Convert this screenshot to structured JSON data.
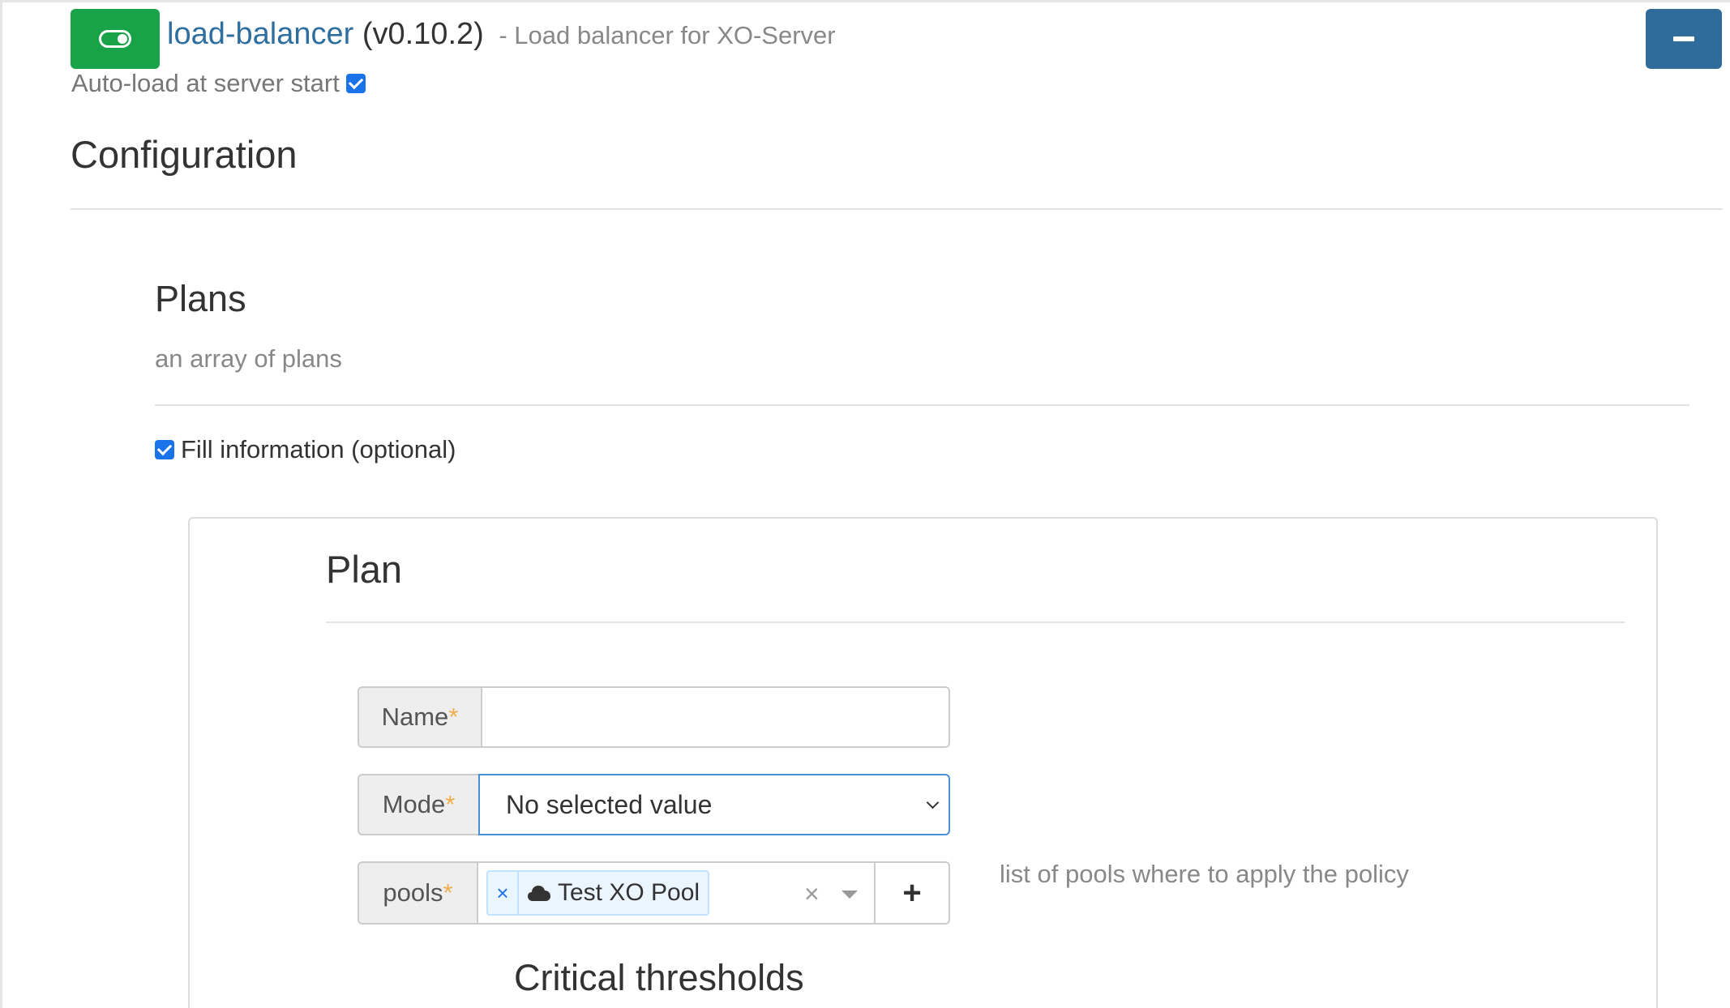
{
  "plugin": {
    "name": "load-balancer",
    "version": "(v0.10.2)",
    "description": "- Load balancer for XO-Server",
    "autoload_label": "Auto-load at server start",
    "autoload_checked": true
  },
  "configuration": {
    "title": "Configuration",
    "plans": {
      "title": "Plans",
      "description": "an array of plans",
      "fill_info_label": "Fill information (optional)",
      "fill_info_checked": true
    },
    "plan": {
      "title": "Plan",
      "name_label": "Name",
      "name_value": "",
      "mode_label": "Mode",
      "mode_value": "No selected value",
      "pools_label": "pools",
      "pools_selected": [
        "Test XO Pool"
      ],
      "pools_help": "list of pools where to apply the policy",
      "required_mark": "*",
      "critical_thresholds_title": "Critical thresholds"
    }
  },
  "icons": {
    "enabled_toggle": "toggle-on-icon",
    "collapse": "minus-icon",
    "pool": "cloud-icon",
    "remove_tag": "×",
    "clear": "×",
    "add": "+"
  },
  "colors": {
    "enabled": "#18a349",
    "primary": "#2f6b9b",
    "link": "#2f6f9f",
    "required": "#f0ad4e"
  }
}
